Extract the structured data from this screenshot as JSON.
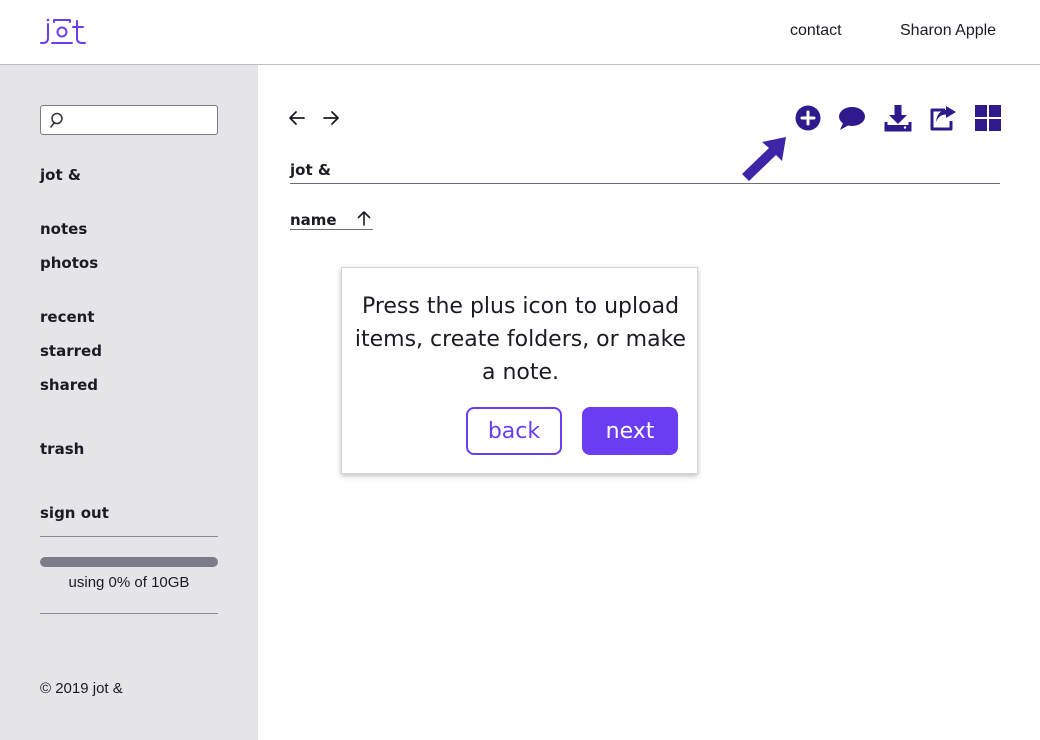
{
  "header": {
    "logo_text": "jot",
    "contact_label": "contact",
    "user_name": "Sharon Apple"
  },
  "sidebar": {
    "search_placeholder": "",
    "brand_label": "jot &",
    "items": [
      {
        "label": "notes"
      },
      {
        "label": "photos"
      },
      {
        "label": "recent"
      },
      {
        "label": "starred"
      },
      {
        "label": "shared"
      },
      {
        "label": "trash"
      },
      {
        "label": "sign out"
      }
    ],
    "storage": {
      "text": "using 0% of 10GB",
      "used_fraction": 0
    },
    "copyright": "© 2019 jot &"
  },
  "main": {
    "breadcrumb": "jot &",
    "sort_column": "name",
    "toolbar_icons": [
      "add-circle-icon",
      "comment-icon",
      "download-icon",
      "share-icon",
      "grid-view-icon"
    ]
  },
  "tooltip": {
    "message": "Press the plus icon to upload items, create folders, or make a note.",
    "back_label": "back",
    "next_label": "next"
  },
  "colors": {
    "accent": "#6a3df2",
    "icon_dark": "#2e1a8c",
    "sidebar_bg": "#e4e4e9"
  }
}
